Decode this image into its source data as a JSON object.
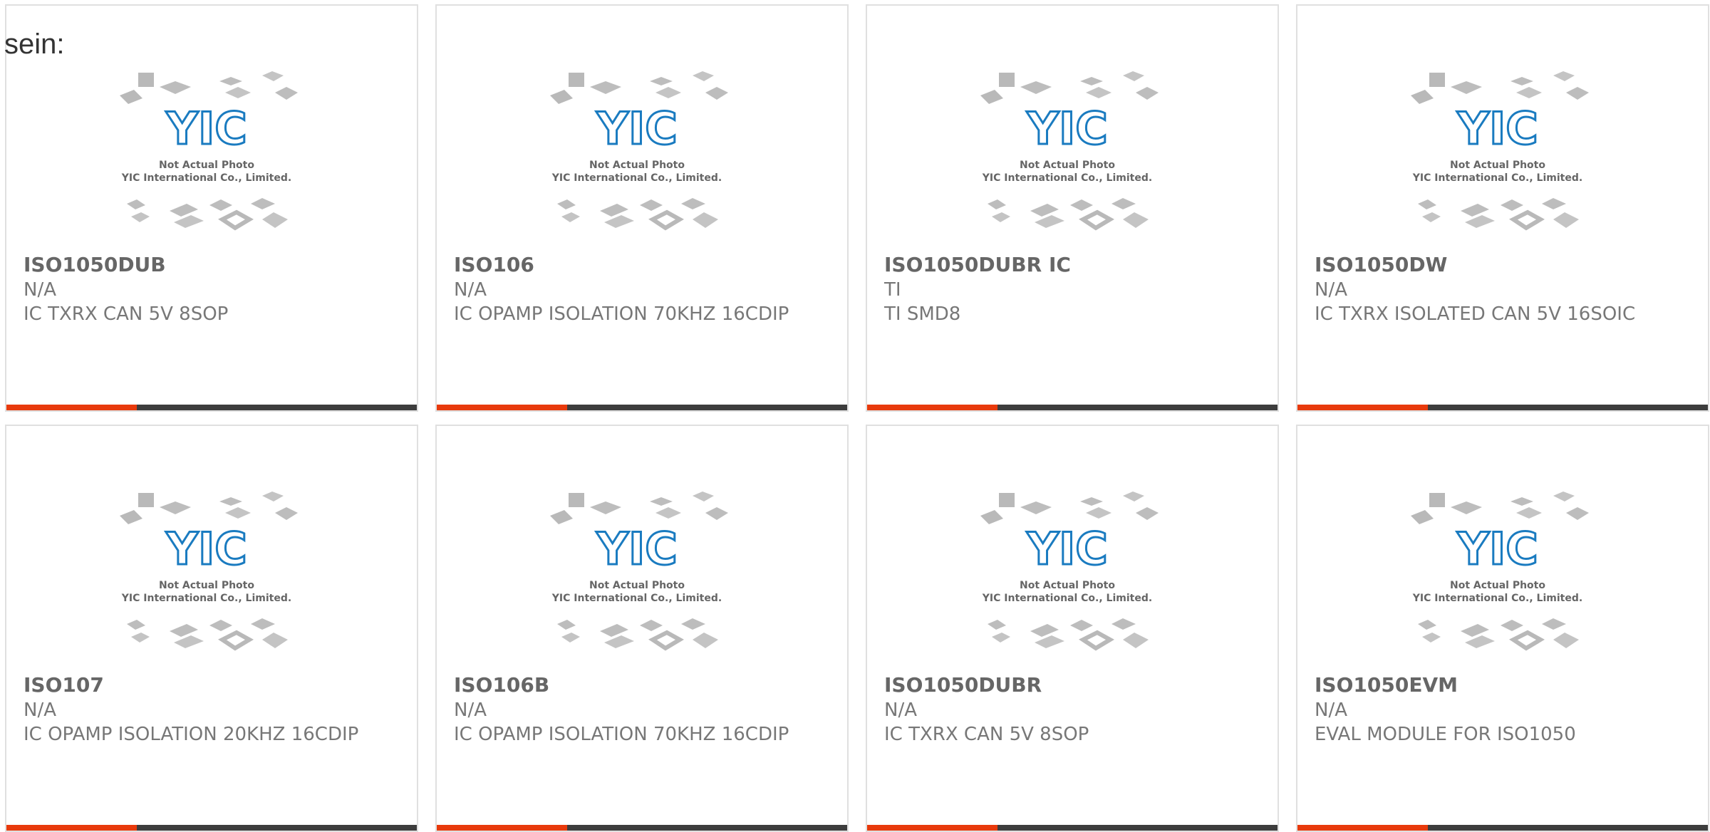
{
  "intro_text": "sein:",
  "placeholder": {
    "line1": "Not Actual Photo",
    "line2": "YIC International Co., Limited."
  },
  "colors": {
    "accent": "#e83a0c",
    "bar": "#3d3d3d",
    "logo": "#1a7bc0",
    "chip": "#b9b9b9"
  },
  "products": [
    {
      "part": "ISO1050DUB",
      "maker": "N/A",
      "desc": "IC TXRX CAN 5V 8SOP"
    },
    {
      "part": "ISO106",
      "maker": "N/A",
      "desc": "IC OPAMP ISOLATION 70KHZ 16CDIP"
    },
    {
      "part": "ISO1050DUBR IC",
      "maker": "TI",
      "desc": "TI SMD8"
    },
    {
      "part": "ISO1050DW",
      "maker": "N/A",
      "desc": "IC TXRX ISOLATED CAN 5V 16SOIC"
    },
    {
      "part": "ISO107",
      "maker": "N/A",
      "desc": "IC OPAMP ISOLATION 20KHZ 16CDIP"
    },
    {
      "part": "ISO106B",
      "maker": "N/A",
      "desc": "IC OPAMP ISOLATION 70KHZ 16CDIP"
    },
    {
      "part": "ISO1050DUBR",
      "maker": "N/A",
      "desc": "IC TXRX CAN 5V 8SOP"
    },
    {
      "part": "ISO1050EVM",
      "maker": "N/A",
      "desc": "EVAL MODULE FOR ISO1050"
    }
  ]
}
